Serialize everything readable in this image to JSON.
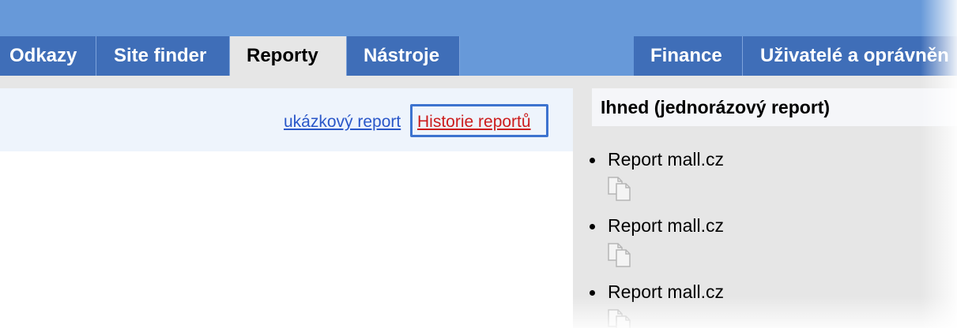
{
  "nav": {
    "tabs_left": [
      "Odkazy",
      "Site finder",
      "Reporty",
      "Nástroje"
    ],
    "tabs_right": [
      "Finance",
      "Uživatelé a oprávněn"
    ],
    "active_tab": "Reporty"
  },
  "toolbar": {
    "sample_report_link": "ukázkový report",
    "history_link": "Historie reportů"
  },
  "panel": {
    "title": "Ihned (jednorázový report)",
    "items": [
      {
        "label": "Report mall.cz"
      },
      {
        "label": "Report mall.cz"
      },
      {
        "label": "Report mall.cz"
      }
    ]
  },
  "colors": {
    "header_bg": "#6799d9",
    "tab_bg": "#3f6eb8",
    "tab_active_bg": "#e6e6e6",
    "link_blue": "#2a57c9",
    "link_red": "#cc1c1c",
    "focus_ring": "#3d73cf",
    "panel_bg": "#e6e6e6",
    "toolbar_bg": "#eef4fc"
  },
  "icons": {
    "item_action": "copy-icon"
  }
}
